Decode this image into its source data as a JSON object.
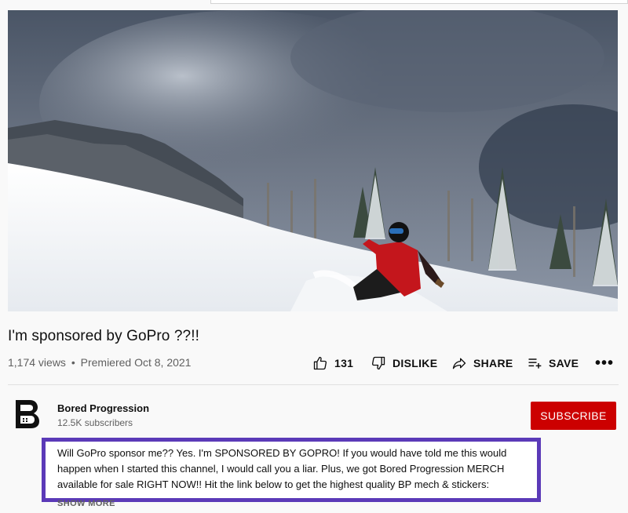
{
  "video": {
    "title": "I'm sponsored by GoPro ??!!",
    "views": "1,174 views",
    "separator": "•",
    "premiered": "Premiered Oct 8, 2021"
  },
  "actions": {
    "like_count": "131",
    "dislike_label": "DISLIKE",
    "share_label": "SHARE",
    "save_label": "SAVE",
    "more_label": "•••"
  },
  "channel": {
    "name": "Bored Progression",
    "subscribers": "12.5K subscribers",
    "subscribe_label": "SUBSCRIBE"
  },
  "description": {
    "lines": [
      "Will GoPro sponsor me?? Yes. I'm SPONSORED BY GOPRO! If you would have told me this would",
      "happen when I started this channel, I would call you a liar.  Plus, we got Bored Progression MERCH",
      "available for sale RIGHT NOW!! Hit the link below to get the highest quality BP mech & stickers:"
    ],
    "show_more_label": "SHOW MORE"
  },
  "colors": {
    "subscribe_red": "#cc0000",
    "highlight_border": "#5b3ab8",
    "secondary_text": "#606060"
  }
}
